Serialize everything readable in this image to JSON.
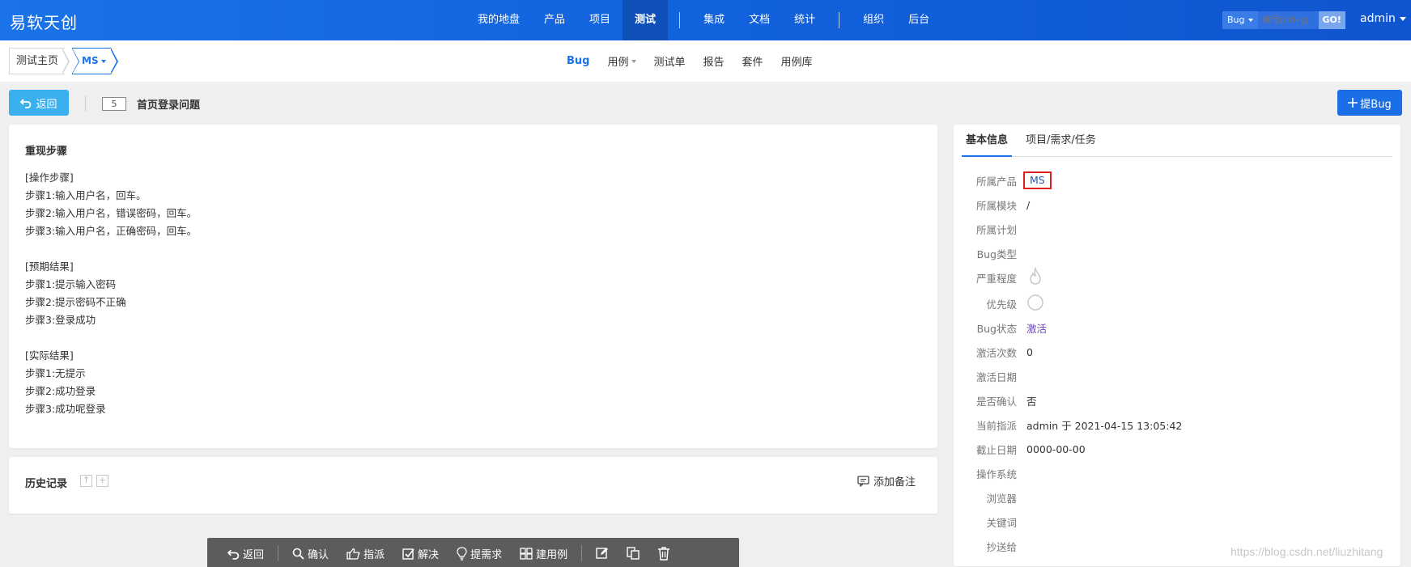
{
  "app": {
    "logo": "易软天创"
  },
  "mainnav": {
    "items": [
      {
        "label": "我的地盘"
      },
      {
        "label": "产品"
      },
      {
        "label": "项目"
      },
      {
        "label": "测试",
        "active": true
      },
      {
        "label": "集成"
      },
      {
        "label": "文档"
      },
      {
        "label": "统计"
      },
      {
        "label": "组织"
      },
      {
        "label": "后台"
      }
    ]
  },
  "search": {
    "type": "Bug",
    "placeholder": "编号(ctrl+g)",
    "go": "GO!"
  },
  "user": {
    "name": "admin"
  },
  "breadcrumb": {
    "home": "测试主页",
    "product": "MS"
  },
  "subnav": {
    "bug": "Bug",
    "case": "用例",
    "testtask": "测试单",
    "report": "报告",
    "suite": "套件",
    "caselib": "用例库"
  },
  "toolbar": {
    "back": "返回",
    "bug_id": "5",
    "bug_title": "首页登录问题",
    "new_bug": "提Bug"
  },
  "steps": {
    "title": "重现步骤",
    "lines": [
      "[操作步骤]",
      "步骤1:输入用户名，回车。",
      "步骤2:输入用户名，错误密码，回车。",
      "步骤3:输入用户名，正确密码，回车。",
      "",
      "[预期结果]",
      "步骤1:提示输入密码",
      "步骤2:提示密码不正确",
      "步骤3:登录成功",
      "",
      "[实际结果]",
      "步骤1:无提示",
      "步骤2:成功登录",
      "步骤3:成功呢登录"
    ]
  },
  "history": {
    "title": "历史记录",
    "add_note": "添加备注"
  },
  "info": {
    "tab_basic": "基本信息",
    "tab_project": "项目/需求/任务",
    "rows": [
      {
        "label": "所属产品",
        "value": "MS"
      },
      {
        "label": "所属模块",
        "value": "/"
      },
      {
        "label": "所属计划",
        "value": ""
      },
      {
        "label": "Bug类型",
        "value": ""
      },
      {
        "label": "严重程度",
        "value": ""
      },
      {
        "label": "优先级",
        "value": ""
      },
      {
        "label": "Bug状态",
        "value": "激活"
      },
      {
        "label": "激活次数",
        "value": "0"
      },
      {
        "label": "激活日期",
        "value": ""
      },
      {
        "label": "是否确认",
        "value": "否"
      },
      {
        "label": "当前指派",
        "value": "admin 于 2021-04-15 13:05:42"
      },
      {
        "label": "截止日期",
        "value": "0000-00-00"
      },
      {
        "label": "操作系统",
        "value": ""
      },
      {
        "label": "浏览器",
        "value": ""
      },
      {
        "label": "关键词",
        "value": ""
      },
      {
        "label": "抄送给",
        "value": ""
      }
    ]
  },
  "actions": {
    "back": "返回",
    "confirm": "确认",
    "assign": "指派",
    "resolve": "解决",
    "to_story": "提需求",
    "create_case": "建用例"
  },
  "watermark": "https://blog.csdn.net/liuzhitang",
  "colors": {
    "topbar": "#1a73e8",
    "accent": "#1a73e8",
    "back_button": "#3bb0ef",
    "status_link": "#6c4bb4",
    "highlight_box": "#e02020"
  }
}
